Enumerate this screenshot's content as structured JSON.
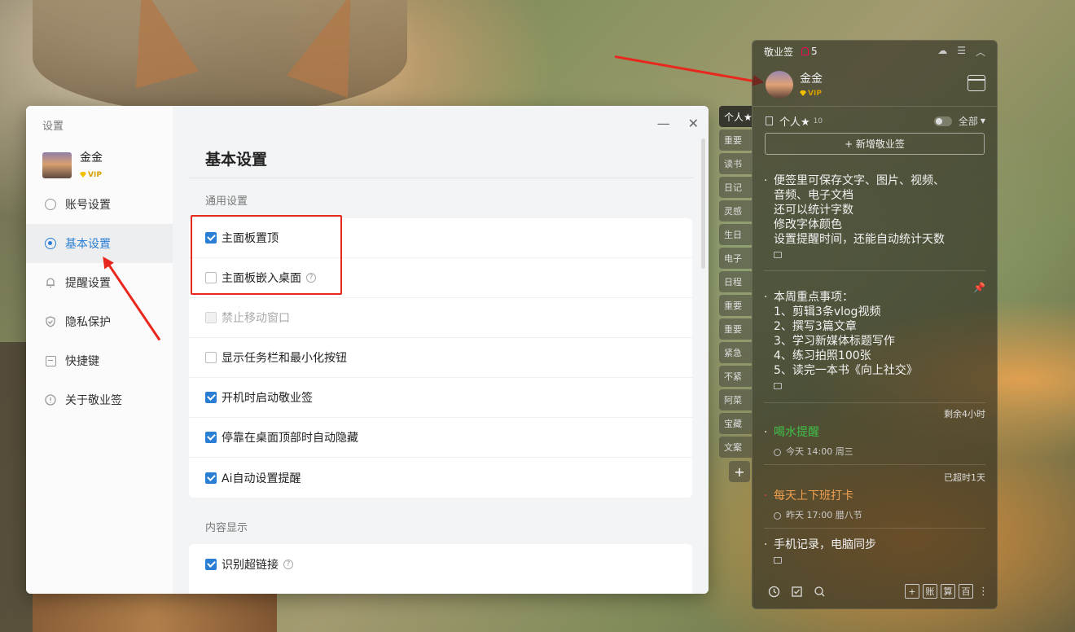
{
  "settings": {
    "title": "设置",
    "user": {
      "name": "金金",
      "vip": "VIP"
    },
    "nav": [
      {
        "label": "账号设置"
      },
      {
        "label": "基本设置"
      },
      {
        "label": "提醒设置"
      },
      {
        "label": "隐私保护"
      },
      {
        "label": "快捷键"
      },
      {
        "label": "关于敬业签"
      }
    ],
    "window_controls": {
      "minimize": "—",
      "close": "✕"
    },
    "page_title": "基本设置",
    "sections": [
      {
        "title": "通用设置",
        "options": [
          {
            "label": "主面板置顶",
            "checked": true
          },
          {
            "label": "主面板嵌入桌面",
            "checked": false,
            "help": "?"
          },
          {
            "label": "禁止移动窗口",
            "checked": false,
            "disabled": true
          },
          {
            "label": "显示任务栏和最小化按钮",
            "checked": false
          },
          {
            "label": "开机时启动敬业签",
            "checked": true
          },
          {
            "label": "停靠在桌面顶部时自动隐藏",
            "checked": true
          },
          {
            "label": "Ai自动设置提醒",
            "checked": true
          }
        ]
      },
      {
        "title": "内容显示",
        "options": [
          {
            "label": "识别超链接",
            "checked": true,
            "help": "?"
          }
        ]
      }
    ]
  },
  "jyq": {
    "app_title": "敬业签",
    "bell_count": "5",
    "user": {
      "name": "金金",
      "vip": "VIP"
    },
    "category": {
      "name": "个人★",
      "count": "10",
      "filter": "全部"
    },
    "add_label": "+ 新增敬业签",
    "tabs": [
      "个人★",
      "重要",
      "读书",
      "日记",
      "灵感",
      "生日",
      "电子",
      "日程",
      "重要",
      "重要",
      "紧急",
      "不紧",
      "阿菜",
      "宝藏",
      "文案"
    ],
    "notes": [
      {
        "text": "便签里可保存文字、图片、视频、\n音频、电子文档\n还可以统计字数\n修改字体颜色\n设置提醒时间，还能自动统计天数"
      },
      {
        "text": "本周重点事项：\n1、剪辑3条vlog视频\n2、撰写3篇文章\n3、学习新媒体标题写作\n4、练习拍照100张\n5、读完一本书《向上社交》"
      },
      {
        "text": "喝水提醒",
        "meta": "剩余4小时",
        "sub": "今天 14:00 周三",
        "color": "#3fbf4a"
      },
      {
        "text": "每天上下班打卡",
        "meta": "已超时1天",
        "sub": "昨天 17:00 腊八节",
        "color": "#f0a050"
      },
      {
        "text": "手机记录，电脑同步"
      }
    ],
    "bottom_boxes": [
      "+",
      "账",
      "算",
      "百"
    ]
  },
  "colors": {
    "accent": "#2a7fd4",
    "annotation_red": "#e8281e",
    "vip_gold": "#f3c000"
  }
}
